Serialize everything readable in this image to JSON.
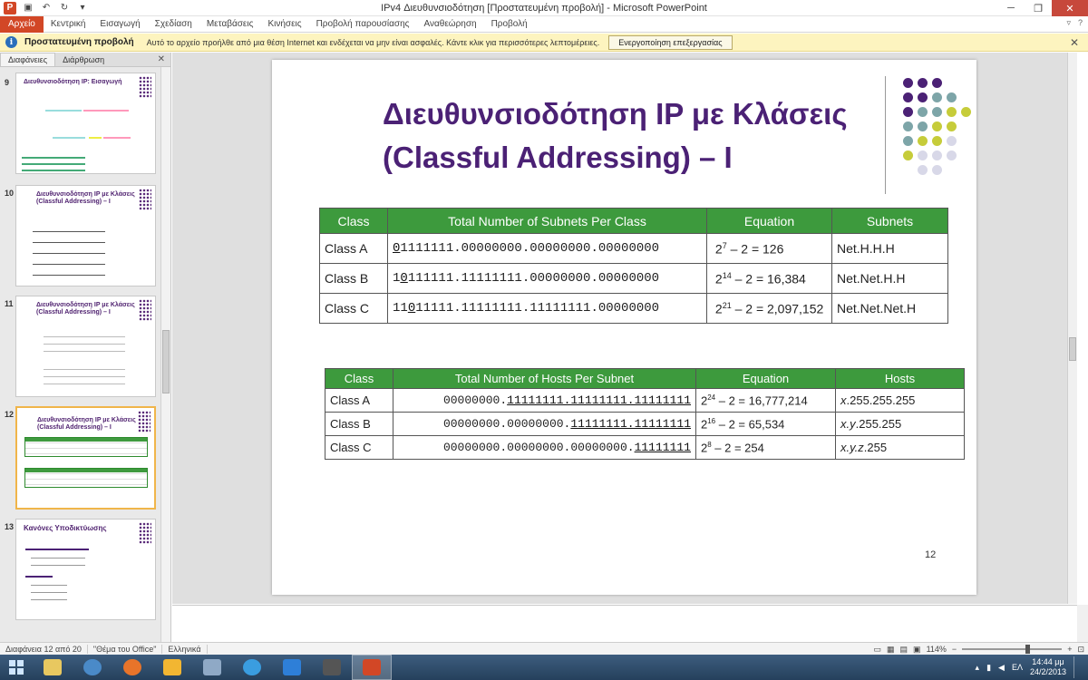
{
  "window": {
    "title": "IPv4 Διευθυνσιοδότηση [Προστατευμένη προβολή] - Microsoft PowerPoint"
  },
  "ribbon": {
    "tabs": [
      "Αρχείο",
      "Κεντρική",
      "Εισαγωγή",
      "Σχεδίαση",
      "Μεταβάσεις",
      "Κινήσεις",
      "Προβολή παρουσίασης",
      "Αναθεώρηση",
      "Προβολή"
    ]
  },
  "protected_view": {
    "title": "Προστατευμένη προβολή",
    "message": "Αυτό το αρχείο προήλθε από μια θέση Internet και ενδέχεται να μην είναι ασφαλές. Κάντε κλικ για περισσότερες λεπτομέρειες.",
    "button": "Ενεργοποίηση επεξεργασίας"
  },
  "pane": {
    "tabs": [
      "Διαφάνειες",
      "Διάρθρωση"
    ]
  },
  "thumbnails": [
    {
      "num": "9",
      "title": "Διευθυνσιοδότηση IP: Εισαγωγή"
    },
    {
      "num": "10",
      "title": "Διευθυνσιοδότηση IP με Κλάσεις (Classful Addressing) – I"
    },
    {
      "num": "11",
      "title": "Διευθυνσιοδότηση IP με Κλάσεις (Classful Addressing) – I"
    },
    {
      "num": "12",
      "title": "Διευθυνσιοδότηση IP με Κλάσεις (Classful Addressing) – I"
    },
    {
      "num": "13",
      "title": "Κανόνες Υποδικτύωσης"
    }
  ],
  "slide": {
    "title_line1": "Διευθυνσιοδότηση IP με Κλάσεις",
    "title_line2": "(Classful Addressing) – I",
    "number": "12",
    "subnets_table": {
      "headers": [
        "Class",
        "Total Number of Subnets Per Class",
        "Equation",
        "Subnets"
      ],
      "rows": [
        {
          "cls": "Class A",
          "pre": "",
          "ul": "0",
          "post": "1111111.00000000.00000000.00000000",
          "eq_base": "2",
          "eq_exp": "7",
          "eq_rest": " – 2 = 126",
          "result": "Net.H.H.H"
        },
        {
          "cls": "Class B",
          "pre": "1",
          "ul": "0",
          "post": "111111.11111111.00000000.00000000",
          "eq_base": "2",
          "eq_exp": "14",
          "eq_rest": " – 2 = 16,384",
          "result": "Net.Net.H.H"
        },
        {
          "cls": "Class C",
          "pre": "11",
          "ul": "0",
          "post": "11111.11111111.11111111.00000000",
          "eq_base": "2",
          "eq_exp": "21",
          "eq_rest": " – 2 = 2,097,152",
          "result": "Net.Net.Net.H"
        }
      ]
    },
    "hosts_table": {
      "headers": [
        "Class",
        "Total Number of Hosts Per Subnet",
        "Equation",
        "Hosts"
      ],
      "rows": [
        {
          "cls": "Class A",
          "plain": "00000000.",
          "ul": "11111111.11111111.11111111",
          "eq_base": "2",
          "eq_exp": "24",
          "eq_rest": " – 2 = 16,777,214",
          "h_it": "x",
          "h_rest": ".255.255.255"
        },
        {
          "cls": "Class B",
          "plain": "00000000.00000000.",
          "ul": "11111111.11111111",
          "eq_base": "2",
          "eq_exp": "16",
          "eq_rest": " – 2 = 65,534",
          "h_it": "x.y",
          "h_rest": ".255.255"
        },
        {
          "cls": "Class C",
          "plain": "00000000.00000000.00000000.",
          "ul": "11111111",
          "eq_base": "2",
          "eq_exp": "8",
          "eq_rest": " – 2 = 254",
          "h_it": "x.y.z",
          "h_rest": ".255"
        }
      ]
    }
  },
  "status": {
    "slide_info": "Διαφάνεια 12 από 20",
    "theme": "\"Θέμα του Office\"",
    "language": "Ελληνικά",
    "zoom": "114%"
  },
  "taskbar": {
    "lang": "ΕΛ",
    "time": "14:44 μμ",
    "date": "24/2/2013"
  },
  "colors": {
    "title": "#4b2175",
    "table_header": "#3d9a3d",
    "file_tab": "#d24726"
  }
}
